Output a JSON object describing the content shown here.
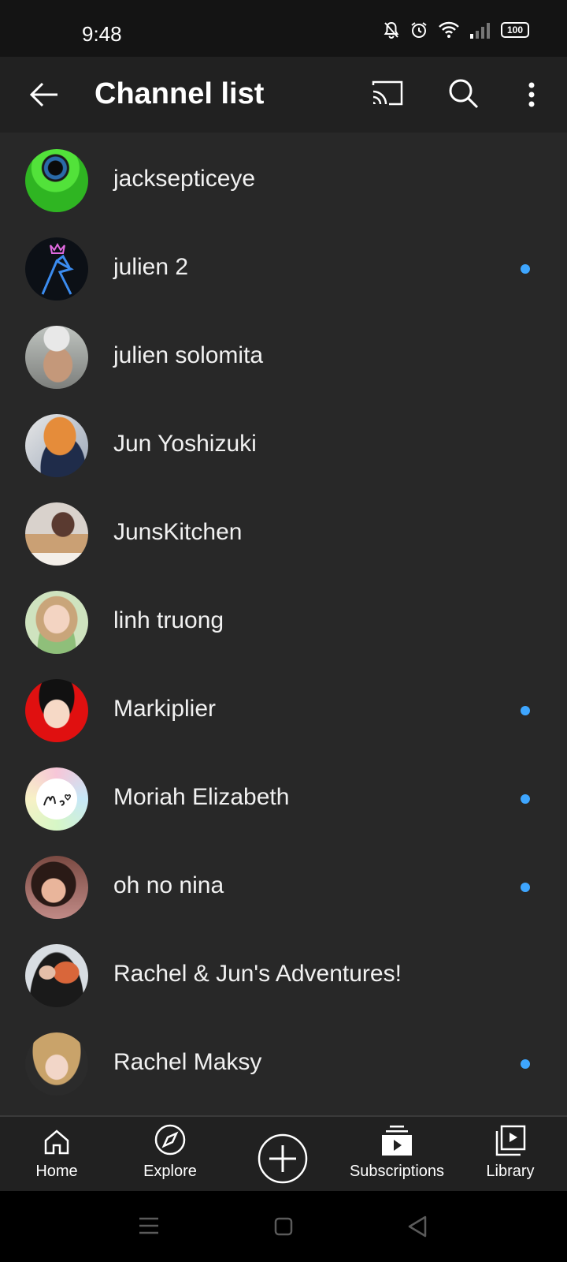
{
  "status_bar": {
    "time": "9:48",
    "battery": "100"
  },
  "app_bar": {
    "title": "Channel list",
    "icons": [
      "back-arrow-icon",
      "cast-icon",
      "search-icon",
      "more-vert-icon"
    ]
  },
  "channels": [
    {
      "name": "jacksepticeye",
      "has_new": false
    },
    {
      "name": "julien 2",
      "has_new": true
    },
    {
      "name": "julien solomita",
      "has_new": false
    },
    {
      "name": "Jun Yoshizuki",
      "has_new": false
    },
    {
      "name": "JunsKitchen",
      "has_new": false
    },
    {
      "name": "linh truong",
      "has_new": false
    },
    {
      "name": "Markiplier",
      "has_new": true
    },
    {
      "name": "Moriah Elizabeth",
      "has_new": true
    },
    {
      "name": "oh no nina",
      "has_new": true
    },
    {
      "name": "Rachel & Jun's Adventures!",
      "has_new": false
    },
    {
      "name": "Rachel Maksy",
      "has_new": true
    }
  ],
  "bottom_nav": {
    "home": "Home",
    "explore": "Explore",
    "subscriptions": "Subscriptions",
    "library": "Library"
  },
  "colors": {
    "background": "#282828",
    "app_bar": "#212121",
    "new_dot": "#3ea6ff"
  }
}
